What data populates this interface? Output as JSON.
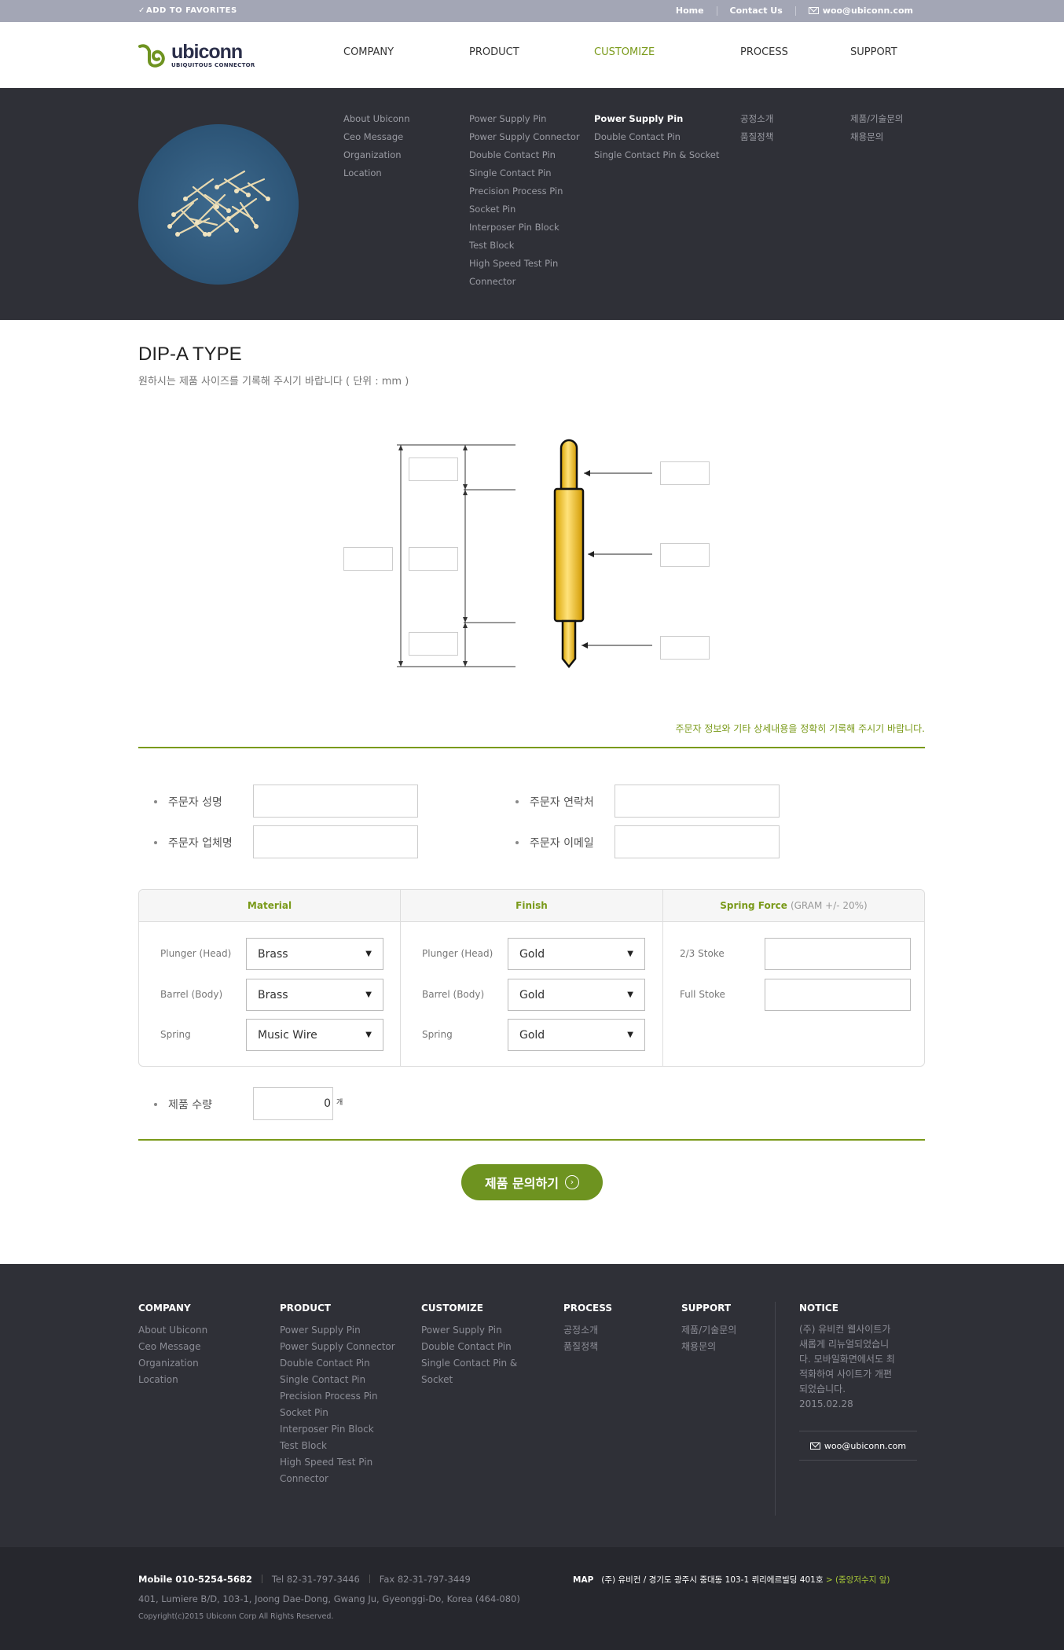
{
  "topbar": {
    "favorites": "ADD TO FAVORITES",
    "home": "Home",
    "contact": "Contact Us",
    "email": "woo@ubiconn.com"
  },
  "logo": {
    "name": "ubiconn",
    "tagline": "UBIQUITOUS CONNECTOR"
  },
  "nav": [
    "COMPANY",
    "PRODUCT",
    "CUSTOMIZE",
    "PROCESS",
    "SUPPORT"
  ],
  "nav_active": "CUSTOMIZE",
  "mega": {
    "company": [
      "About Ubiconn",
      "Ceo Message",
      "Organization",
      "Location"
    ],
    "product": [
      "Power Supply Pin",
      "Power Supply Connector",
      "Double Contact Pin",
      "Single Contact Pin",
      "Precision Process Pin",
      "Socket Pin",
      "Interposer Pin Block",
      "Test Block",
      "High Speed Test Pin",
      "Connector"
    ],
    "customize": [
      "Power Supply Pin",
      "Double Contact Pin",
      "Single Contact Pin & Socket"
    ],
    "process": [
      "공정소개",
      "품질정책"
    ],
    "support": [
      "제품/기술문의",
      "채용문의"
    ]
  },
  "main": {
    "title": "DIP-A TYPE",
    "subtitle": "원하시는 제품 사이즈를 기록해 주시기 바랍니다 ( 단위 : mm )",
    "note": "주문자 정보와 기타 상세내용을 정확히 기록해 주시기 바랍니다."
  },
  "form": {
    "name_label": "주문자 성명",
    "contact_label": "주문자 연락처",
    "company_label": "주문자 업체명",
    "email_label": "주문자 이메일",
    "qty_label": "제품 수량",
    "qty_value": "0",
    "qty_unit": "개",
    "submit": "제품 문의하기"
  },
  "spec": {
    "material": {
      "header": "Material",
      "rows": [
        {
          "label": "Plunger (Head)",
          "value": "Brass"
        },
        {
          "label": "Barrel (Body)",
          "value": "Brass"
        },
        {
          "label": "Spring",
          "value": "Music Wire"
        }
      ]
    },
    "finish": {
      "header": "Finish",
      "rows": [
        {
          "label": "Plunger (Head)",
          "value": "Gold"
        },
        {
          "label": "Barrel (Body)",
          "value": "Gold"
        },
        {
          "label": "Spring",
          "value": "Gold"
        }
      ]
    },
    "spring": {
      "header": "Spring Force",
      "header_note": "(GRAM +/- 20%)",
      "rows": [
        {
          "label": "2/3 Stoke"
        },
        {
          "label": "Full Stoke"
        }
      ]
    }
  },
  "footer": {
    "company": {
      "title": "COMPANY",
      "items": [
        "About Ubiconn",
        "Ceo Message",
        "Organization",
        "Location"
      ]
    },
    "product": {
      "title": "PRODUCT",
      "items": [
        "Power Supply Pin",
        "Power Supply Connector",
        "Double Contact Pin",
        "Single Contact Pin",
        "Precision Process Pin",
        "Socket Pin",
        "Interposer Pin Block",
        "Test Block",
        "High Speed Test Pin",
        "Connector"
      ]
    },
    "customize": {
      "title": "CUSTOMIZE",
      "items": [
        "Power Supply Pin",
        "Double Contact Pin",
        "Single Contact Pin &",
        "Socket"
      ]
    },
    "process": {
      "title": "PROCESS",
      "items": [
        "공정소개",
        "품질정책"
      ]
    },
    "support": {
      "title": "SUPPORT",
      "items": [
        "제품/기술문의",
        "채용문의"
      ]
    },
    "notice": {
      "title": "NOTICE",
      "lines": [
        "(주) 유비컨 웹사이트가",
        "새롭게 리뉴얼되었습니",
        "다. 모바일화면에서도 최",
        "적화하여 사이트가 개편",
        "되었습니다."
      ],
      "date": "2015.02.28",
      "email": "woo@ubiconn.com"
    }
  },
  "bottom": {
    "mobile": "Mobile 010-5254-5682",
    "tel": "Tel 82-31-797-3446",
    "fax": "Fax 82-31-797-3449",
    "address": "401, Lumiere B/D, 103-1, Joong Dae-Dong, Gwang Ju, Gyeonggi-Do, Korea (464-080)",
    "copyright": "Copyright(c)2015 Ubiconn Corp All Rights Reserved.",
    "map_label": "MAP",
    "map_address": "(주) 유비컨 / 경기도 광주시 중대동 103-1 뤼리에르빌딩 401호",
    "map_link": "> (중앙저수지 앞)"
  },
  "colors": {
    "accent": "#7a9a1a",
    "dark": "#2f3037",
    "topbar": "#a3a6b5"
  }
}
